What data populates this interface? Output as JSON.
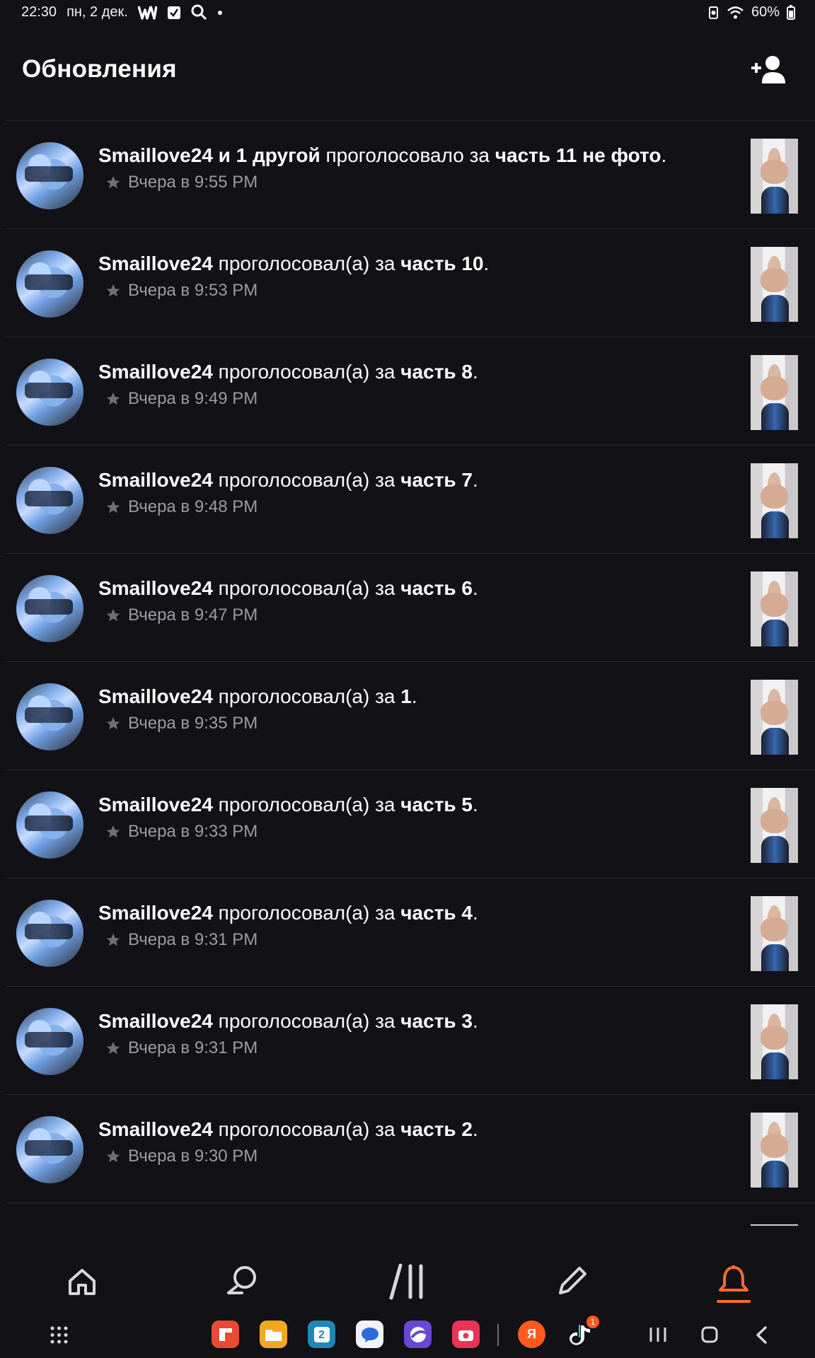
{
  "status_bar": {
    "time": "22:30",
    "date": "пн, 2 дек.",
    "battery": "60%"
  },
  "header": {
    "title": "Обновления"
  },
  "feed": [
    {
      "actor": "Smaillove24 и 1 другой",
      "action": " проголосовало за ",
      "target": "часть 11 не фото",
      "end": ".",
      "time": "Вчера в 9:55 PM"
    },
    {
      "actor": "Smaillove24",
      "action": " проголосовал(а) за ",
      "target": "часть 10",
      "end": ".",
      "time": "Вчера в 9:53 PM"
    },
    {
      "actor": "Smaillove24",
      "action": " проголосовал(а) за ",
      "target": "часть 8",
      "end": ".",
      "time": "Вчера в 9:49 PM"
    },
    {
      "actor": "Smaillove24",
      "action": " проголосовал(а) за ",
      "target": "часть 7",
      "end": ".",
      "time": "Вчера в 9:48 PM"
    },
    {
      "actor": "Smaillove24",
      "action": " проголосовал(а) за ",
      "target": "часть 6",
      "end": ".",
      "time": "Вчера в 9:47 PM"
    },
    {
      "actor": "Smaillove24",
      "action": " проголосовал(а) за ",
      "target": "1",
      "end": ".",
      "time": "Вчера в 9:35 PM"
    },
    {
      "actor": "Smaillove24",
      "action": " проголосовал(а) за ",
      "target": "часть 5",
      "end": ".",
      "time": "Вчера в 9:33 PM"
    },
    {
      "actor": "Smaillove24",
      "action": " проголосовал(а) за ",
      "target": "часть 4",
      "end": ".",
      "time": "Вчера в 9:31 PM"
    },
    {
      "actor": "Smaillove24",
      "action": " проголосовал(а) за ",
      "target": "часть 3",
      "end": ".",
      "time": "Вчера в 9:31 PM"
    },
    {
      "actor": "Smaillove24",
      "action": " проголосовал(а) за ",
      "target": "часть 2",
      "end": ".",
      "time": "Вчера в 9:30 PM"
    }
  ],
  "bottom_nav": {
    "items": [
      "home-icon",
      "search-icon",
      "library-icon",
      "write-icon",
      "notifications-icon"
    ],
    "active": "notifications-icon",
    "accent": "#ff6a2b"
  },
  "system_bar": {
    "tiktok_badge": "1"
  }
}
